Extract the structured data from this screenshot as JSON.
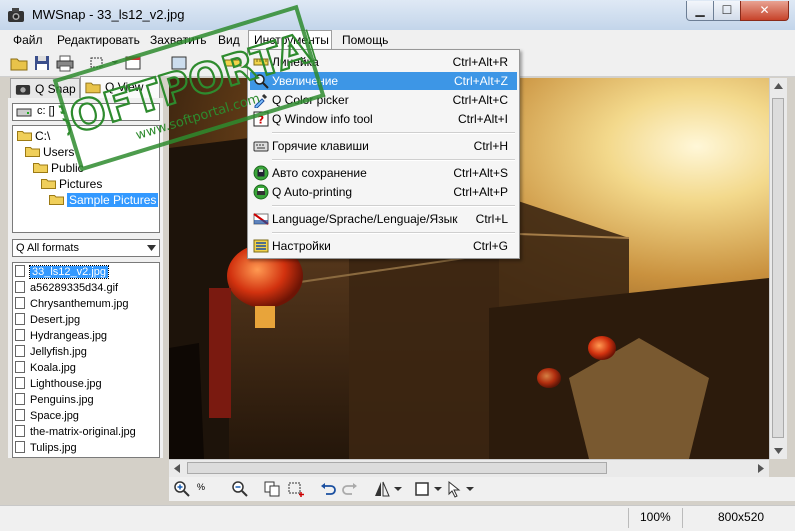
{
  "window": {
    "title": "MWSnap - 33_ls12_v2.jpg",
    "controls": {
      "minimize": "▁",
      "maximize": "☐",
      "close": "✕"
    }
  },
  "menubar": [
    "Файл",
    "Редактировать",
    "Захватить",
    "Вид",
    "Инструменты",
    "Помощь"
  ],
  "tabs": [
    {
      "label": "Q Snap"
    },
    {
      "label": "Q View"
    }
  ],
  "drive": {
    "value": "c: []"
  },
  "folders": [
    {
      "label": "C:\\",
      "depth": 0
    },
    {
      "label": "Users",
      "depth": 1
    },
    {
      "label": "Public",
      "depth": 2
    },
    {
      "label": "Pictures",
      "depth": 3
    },
    {
      "label": "Sample Pictures",
      "depth": 4,
      "selected": true
    }
  ],
  "format_filter": {
    "value": "Q All formats"
  },
  "files": [
    {
      "name": "33_ls12_v2.jpg",
      "selected": true
    },
    {
      "name": "a56289335d34.gif"
    },
    {
      "name": "Chrysanthemum.jpg"
    },
    {
      "name": "Desert.jpg"
    },
    {
      "name": "Hydrangeas.jpg"
    },
    {
      "name": "Jellyfish.jpg"
    },
    {
      "name": "Koala.jpg"
    },
    {
      "name": "Lighthouse.jpg"
    },
    {
      "name": "Penguins.jpg"
    },
    {
      "name": "Space.jpg"
    },
    {
      "name": "the-matrix-original.jpg"
    },
    {
      "name": "Tulips.jpg"
    }
  ],
  "tools_menu": {
    "items": [
      {
        "label": "Линейка",
        "shortcut": "Ctrl+Alt+R",
        "icon": "ruler-icon"
      },
      {
        "label": "Увеличение",
        "shortcut": "Ctrl+Alt+Z",
        "icon": "magnifier-icon",
        "highlighted": true
      },
      {
        "label": "Q Color picker",
        "shortcut": "Ctrl+Alt+C",
        "icon": "eyedropper-icon"
      },
      {
        "label": "Q Window info tool",
        "shortcut": "Ctrl+Alt+I",
        "icon": "window-info-icon"
      },
      {
        "label": "Горячие клавиши",
        "shortcut": "Ctrl+H",
        "icon": "hotkeys-icon"
      },
      {
        "label": "Авто сохранение",
        "shortcut": "Ctrl+Alt+S",
        "icon": "autosave-icon"
      },
      {
        "label": "Q Auto-printing",
        "shortcut": "Ctrl+Alt+P",
        "icon": "autoprint-icon"
      },
      {
        "label": "Language/Sprache/Lenguaje/Язык",
        "shortcut": "Ctrl+L",
        "icon": "language-flag-icon"
      },
      {
        "label": "Настройки",
        "shortcut": "Ctrl+G",
        "icon": "settings-icon"
      }
    ]
  },
  "bottom_toolbar": {
    "zoom_label": "%"
  },
  "statusbar": {
    "zoom": "100%",
    "size": "800x520"
  },
  "watermark": {
    "brand": "SOFTPORTAL",
    "url": "www.softportal.com"
  },
  "colors": {
    "menu_highlight": "#3d96e6",
    "selection": "#3399ff",
    "watermark": "#2e8b2e"
  }
}
